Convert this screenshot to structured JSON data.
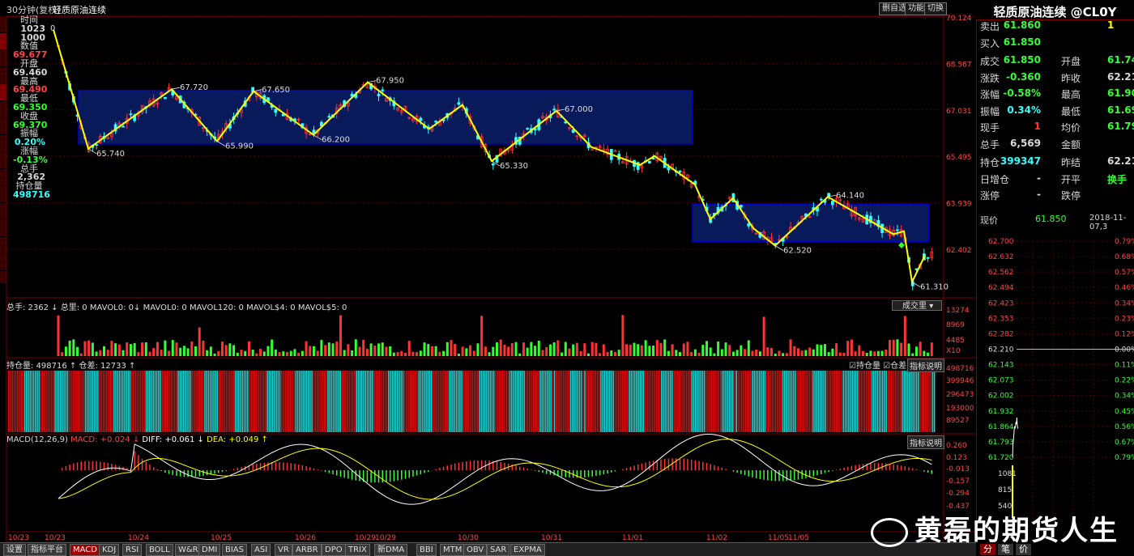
{
  "header": {
    "period": "30分钟(复权)",
    "title": "轻质原油连续",
    "buttons": [
      "删自选",
      "功能",
      "切换"
    ]
  },
  "colors": {
    "up": "#ff3333",
    "down": "#33ffff",
    "yellow": "#ffff00",
    "box": "#0000cc",
    "grid": "#550000"
  },
  "info": [
    {
      "k": "时间",
      "v": "1023",
      "c": "#d8d8d8"
    },
    {
      "k": "",
      "v": "1000",
      "c": "#d8d8d8"
    },
    {
      "k": "数值",
      "v": "69.677",
      "c": "#ff4444"
    },
    {
      "k": "开盘",
      "v": "69.460",
      "c": "#d8d8d8"
    },
    {
      "k": "最高",
      "v": "69.490",
      "c": "#ff4444"
    },
    {
      "k": "最低",
      "v": "69.350",
      "c": "#33ff33"
    },
    {
      "k": "收盘",
      "v": "69.370",
      "c": "#33ff33"
    },
    {
      "k": "振幅",
      "v": "0.20%",
      "c": "#33ffff"
    },
    {
      "k": "涨幅",
      "v": "-0.13%",
      "c": "#33ff33"
    },
    {
      "k": "总手",
      "v": "2,362",
      "c": "#d8d8d8"
    },
    {
      "k": "持仓量",
      "v": "498716",
      "c": "#33ffff"
    }
  ],
  "quote": {
    "title": "轻质原油连续 @CL0Y",
    "rows": [
      {
        "l": "卖出",
        "v": "61.860",
        "vc": "#33ff33",
        "r": "",
        "rv": "1",
        "rvc": "#ffff00"
      },
      {
        "l": "买入",
        "v": "61.850",
        "vc": "#33ff33",
        "r": "",
        "rv": "",
        "rvc": "#ffff00"
      },
      {
        "l": "成交",
        "v": "61.850",
        "vc": "#33ff33",
        "r": "开盘",
        "rv": "61.74",
        "rvc": "#33ff33"
      },
      {
        "l": "涨跌",
        "v": "-0.360",
        "vc": "#33ff33",
        "r": "昨收",
        "rv": "62.21",
        "rvc": "#d8d8d8"
      },
      {
        "l": "涨幅",
        "v": "-0.58%",
        "vc": "#33ff33",
        "r": "最高",
        "rv": "61.90",
        "rvc": "#33ff33"
      },
      {
        "l": "振幅",
        "v": "0.34%",
        "vc": "#33ffff",
        "r": "最低",
        "rv": "61.69",
        "rvc": "#33ff33"
      },
      {
        "l": "现手",
        "v": "1",
        "vc": "#ff3333",
        "r": "均价",
        "rv": "61.79",
        "rvc": "#33ff33"
      },
      {
        "l": "总手",
        "v": "6,569",
        "vc": "#d8d8d8",
        "r": "金额",
        "rv": "",
        "rvc": "#d8d8d8"
      },
      {
        "l": "持仓",
        "v": "399347",
        "vc": "#33ffff",
        "r": "昨结",
        "rv": "62.21",
        "rvc": "#d8d8d8"
      },
      {
        "l": "日增仓",
        "v": "-",
        "vc": "#d8d8d8",
        "r": "开平",
        "rv": "换手",
        "rvc": "#33ff33"
      },
      {
        "l": "涨停",
        "v": "-",
        "vc": "#d8d8d8",
        "r": "跌停",
        "rv": "",
        "rvc": "#d8d8d8"
      }
    ],
    "now_label": "现价",
    "now_price": "61.850",
    "now_date": "2018-11-07,3"
  },
  "chart_data": [
    {
      "type": "line",
      "name": "main-kline",
      "y_ticks": [
        "70.124",
        "68.567",
        "67.031",
        "65.495",
        "63.939",
        "62.402"
      ],
      "ylim": [
        61.0,
        70.2
      ],
      "x_tick_labels": [
        "10/23",
        "10/23",
        "10/24",
        "10/25",
        "10/26",
        "10/29",
        "10/29",
        "10/30",
        "10/31",
        "11/01",
        "11/02",
        "11/05",
        "11/05"
      ],
      "zigzag": [
        69.7,
        65.74,
        67.72,
        65.99,
        67.65,
        66.2,
        67.95,
        66.4,
        67.2,
        65.33,
        67.0,
        65.8,
        65.2,
        65.5,
        64.55,
        63.4,
        64.1,
        63.1,
        62.52,
        64.14,
        62.9,
        63.0,
        61.31,
        62.2
      ],
      "annotations": [
        "65.740",
        "67.720",
        "65.990",
        "67.650",
        "66.200",
        "67.950",
        "65.330",
        "67.000",
        "64.140",
        "62.520",
        "61.310"
      ],
      "boxes": [
        {
          "from": "10/23",
          "to": "11/01",
          "top": 67.68,
          "bottom": 65.9
        },
        {
          "from": "11/01",
          "to": "11/07",
          "top": 63.9,
          "bottom": 62.66
        }
      ]
    },
    {
      "type": "bar",
      "name": "volume",
      "header": "总手: 2362 ↓  总里: 0  MAVOL0: 0↓  MAVOL0: 0  MAVOL120: 0  MAVOL$4: 0  MAVOL$5: 0",
      "y_ticks": [
        "13274",
        "8969",
        "4485",
        "X10"
      ],
      "select_label": "成交里"
    },
    {
      "type": "bar",
      "name": "open-interest",
      "header": "持仓量: 498716 ↑  仓差: 12733 ↑",
      "legend": [
        "持仓量",
        "仓差"
      ],
      "button": "指标说明",
      "y_ticks": [
        "498716",
        "399946",
        "296473",
        "193000",
        "89527"
      ]
    },
    {
      "type": "line",
      "name": "macd",
      "header_parts": [
        {
          "t": "MACD(12,26,9)",
          "c": "#d8d8d8"
        },
        {
          "t": "MACD: +0.024 ↓",
          "c": "#ff4444"
        },
        {
          "t": "DIFF: +0.061 ↓",
          "c": "#ffffff"
        },
        {
          "t": "DEA: +0.049 ↑",
          "c": "#ffff00"
        }
      ],
      "button": "指标说明",
      "y_ticks": [
        "0.260",
        "0.123",
        "-0.013",
        "-0.157",
        "-0.294",
        "-0.437"
      ]
    },
    {
      "type": "line",
      "name": "intraday",
      "y_ticks_left": [
        "62.700",
        "62.632",
        "62.562",
        "62.494",
        "62.423",
        "62.353",
        "62.282",
        "62.210",
        "62.143",
        "62.073",
        "62.002",
        "61.932",
        "61.864",
        "61.793",
        "61.720"
      ],
      "y_ticks_right": [
        "0.79%",
        "0.68%",
        "0.57%",
        "0.46%",
        "0.34%",
        "0.23%",
        "0.12%",
        "0.00%",
        "0.11%",
        "0.22%",
        "0.34%",
        "0.45%",
        "0.56%",
        "0.67%",
        "0.79%"
      ],
      "vol_ticks": [
        "1081",
        "815",
        "540"
      ],
      "prev_close": 62.21,
      "prices": [
        61.72,
        61.78,
        61.8,
        61.83,
        61.86,
        61.85,
        61.86,
        61.88,
        61.87,
        61.9,
        61.86,
        61.85
      ]
    }
  ],
  "bottom_tabs": [
    "设置",
    "指标平台",
    "MACD",
    "KDJ",
    "RSI",
    "BOLL",
    "W&R",
    "DMI",
    "BIAS",
    "ASI",
    "VR",
    "ARBR",
    "DPO",
    "TRIX",
    "新DMA",
    "BBI",
    "MTM",
    "OBV",
    "SAR",
    "EXPMA"
  ],
  "right_bottom_tabs": [
    "分",
    "笔",
    "价"
  ],
  "watermark": "黄磊的期货人生"
}
